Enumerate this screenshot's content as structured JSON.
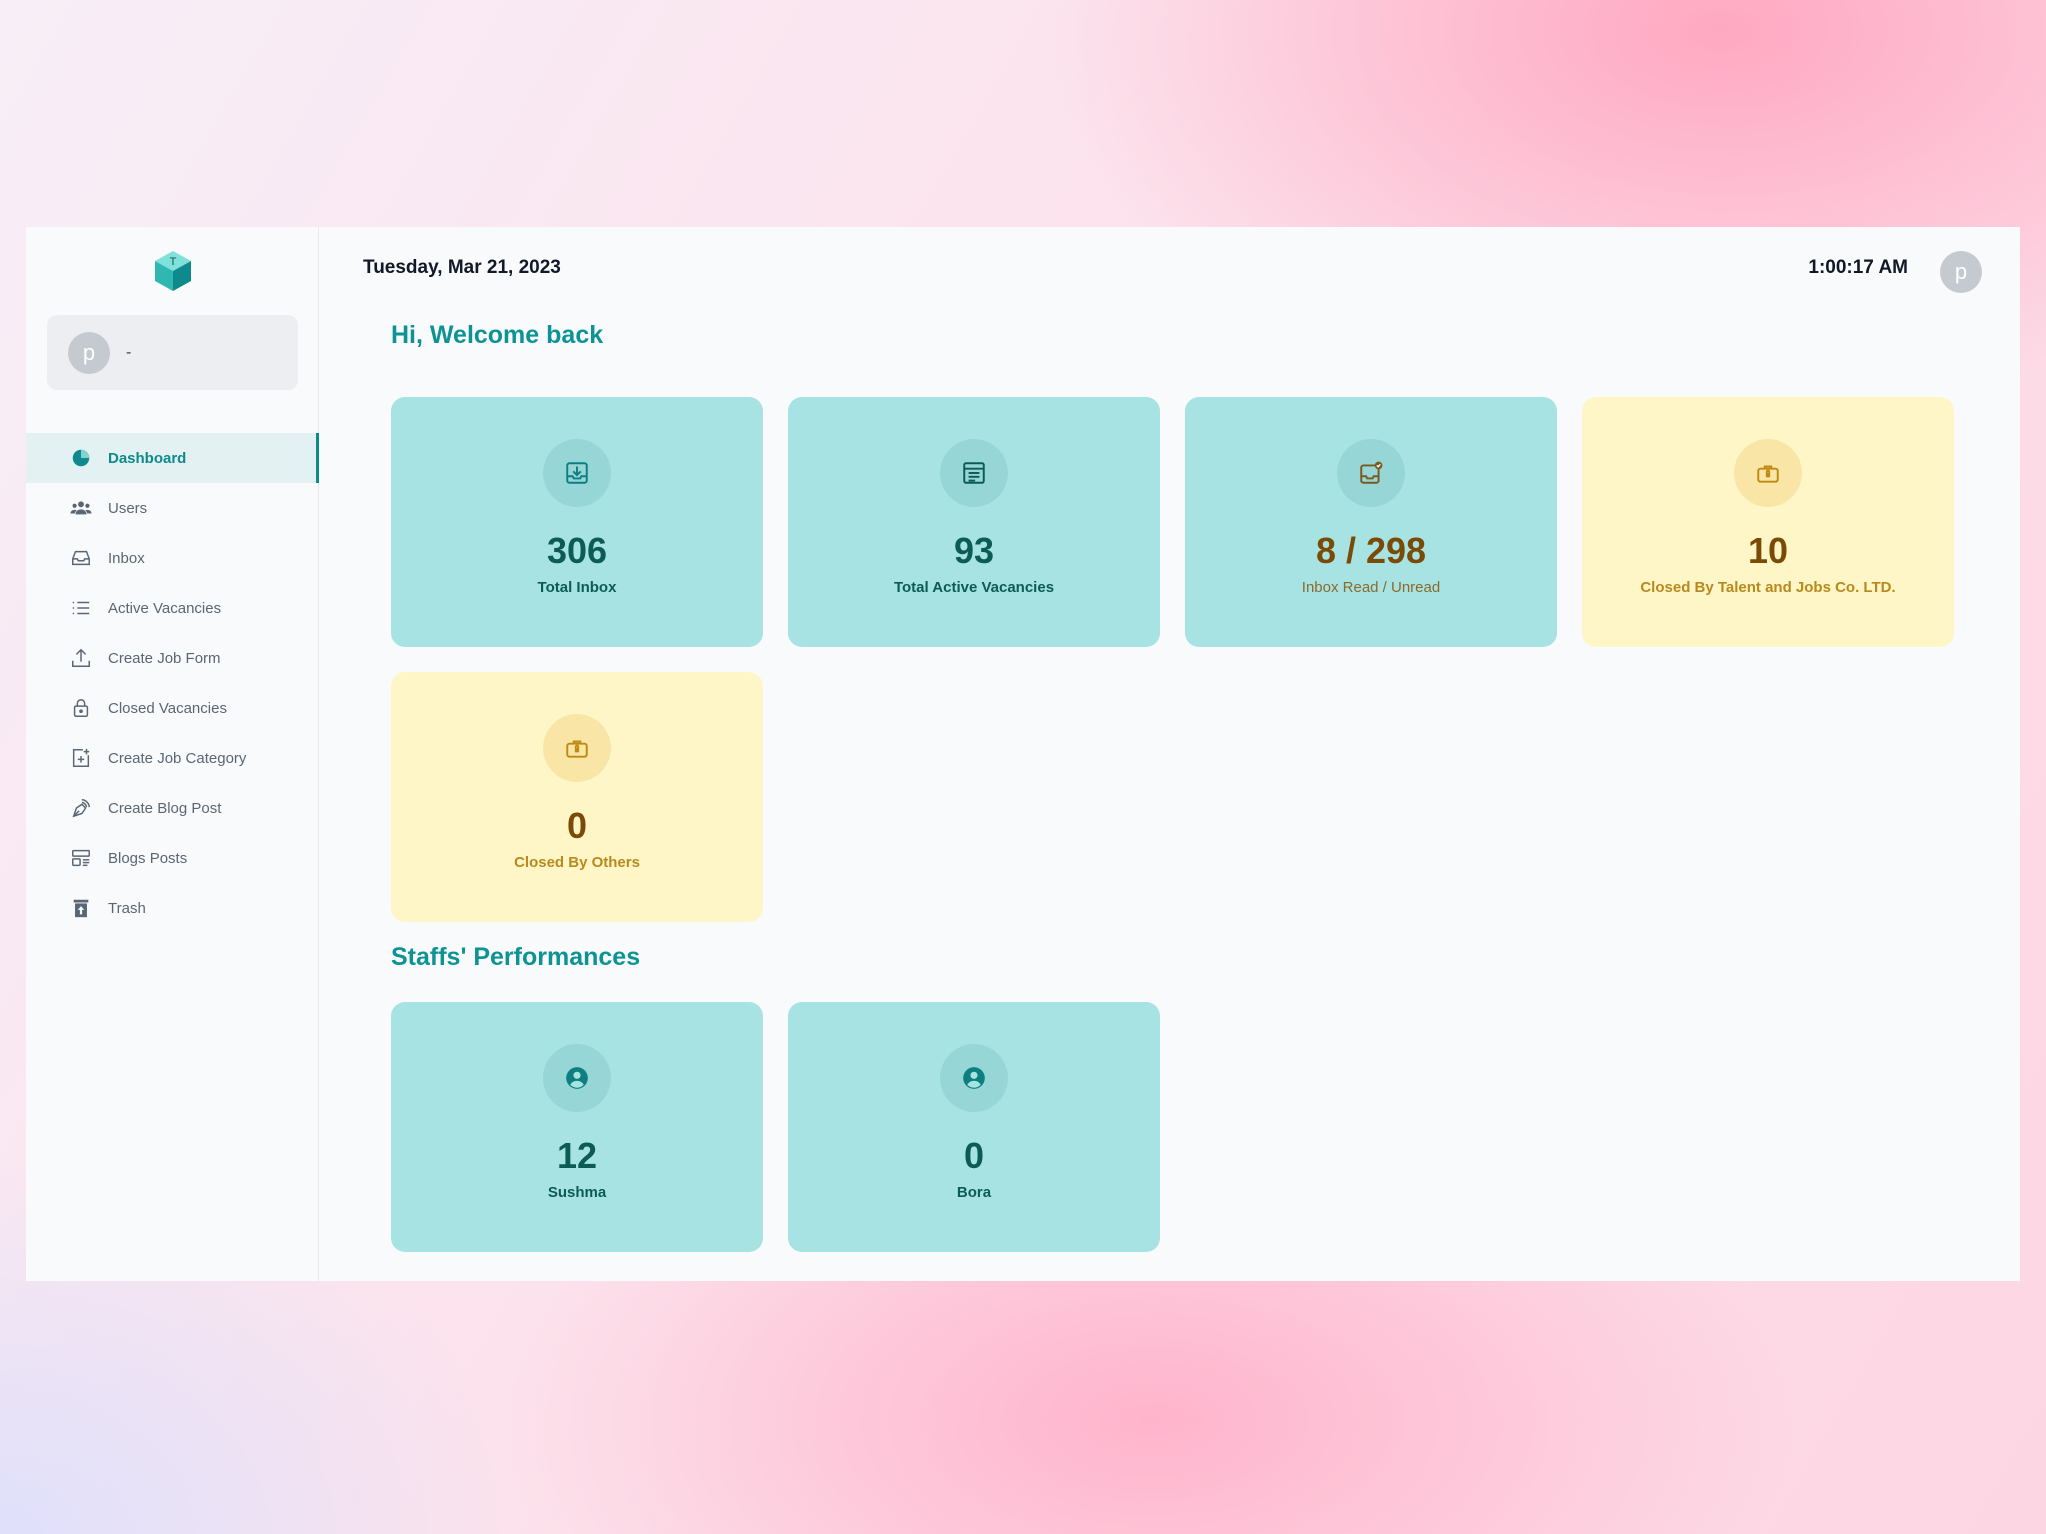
{
  "header": {
    "date": "Tuesday, Mar 21, 2023",
    "time": "1:00:17 AM",
    "avatar_initial": "p"
  },
  "account": {
    "avatar_initial": "p",
    "name": "-"
  },
  "sidebar": {
    "items": [
      {
        "label": "Dashboard",
        "icon": "pie-chart-icon",
        "active": true
      },
      {
        "label": "Users",
        "icon": "users-icon"
      },
      {
        "label": "Inbox",
        "icon": "inbox-icon"
      },
      {
        "label": "Active Vacancies",
        "icon": "list-icon"
      },
      {
        "label": "Create Job Form",
        "icon": "upload-icon"
      },
      {
        "label": "Closed Vacancies",
        "icon": "lock-icon"
      },
      {
        "label": "Create Job Category",
        "icon": "add-folder-icon"
      },
      {
        "label": "Create Blog Post",
        "icon": "pen-icon"
      },
      {
        "label": "Blogs Posts",
        "icon": "posts-icon"
      },
      {
        "label": "Trash",
        "icon": "trash-icon"
      }
    ]
  },
  "main": {
    "welcome": "Hi, Welcome back",
    "stats": [
      {
        "value": "306",
        "label": "Total Inbox",
        "icon": "inbox-download-icon"
      },
      {
        "value": "93",
        "label": "Total Active Vacancies",
        "icon": "calendar-list-icon"
      },
      {
        "value": "8 / 298",
        "label": "Inbox Read / Unread",
        "icon": "inbox-check-icon"
      },
      {
        "value": "10",
        "label": "Closed By Talent and Jobs Co. LTD.",
        "icon": "briefcase-lock-icon"
      },
      {
        "value": "0",
        "label": "Closed By Others",
        "icon": "briefcase-lock-icon"
      }
    ],
    "staff_title": "Staffs' Performances",
    "staff": [
      {
        "value": "12",
        "label": "Sushma",
        "icon": "user-circle-icon"
      },
      {
        "value": "0",
        "label": "Bora",
        "icon": "user-circle-icon"
      }
    ]
  },
  "colors": {
    "accent": "#0e9395",
    "teal_card": "#a8e3e4",
    "yellow_card": "#fff6c8"
  }
}
